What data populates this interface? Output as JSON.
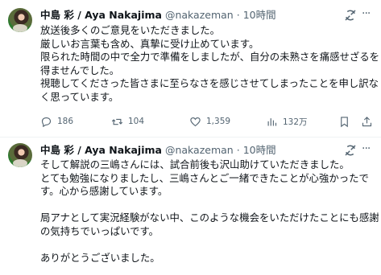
{
  "tweets": [
    {
      "author": "中島 彩 / Aya Nakajima",
      "handle": "@nakazeman",
      "time": "10時間",
      "lines": [
        "放送後多くのご意見をいただきました。",
        "厳しいお言葉も含め、真摯に受け止めています。",
        "限られた時間の中で全力で準備をしましたが、自分の未熟さを痛感せざるを",
        "得ませんでした。",
        "視聴してくださった皆さまに至らなさを感じさせてしまったことを申し訳な",
        "く思っています。"
      ],
      "actions": {
        "replies": "186",
        "retweets": "104",
        "likes": "1,359",
        "views": "132万"
      }
    },
    {
      "author": "中島 彩 / Aya Nakajima",
      "handle": "@nakazeman",
      "time": "10時間",
      "lines": [
        "そして解説の三嶋さんには、試合前後も沢山助けていただきました。",
        "とても勉強になりましたし、三嶋さんとご一緒できたことが心強かったで",
        "す。心から感謝しています。",
        "",
        "局アナとして実況経験がない中、このような機会をいただけたことにも感謝",
        "の気持ちでいっぱいです。",
        "",
        "ありがとうございました。"
      ]
    }
  ],
  "icons": {
    "grok": "grok-icon",
    "more": "more-icon",
    "reply": "reply-icon",
    "retweet": "retweet-icon",
    "like": "heart-icon",
    "views": "views-icon",
    "bookmark": "bookmark-icon",
    "share": "share-icon"
  },
  "colors": {
    "text": "#0f1419",
    "muted": "#536471",
    "divider": "#eff3f4"
  }
}
